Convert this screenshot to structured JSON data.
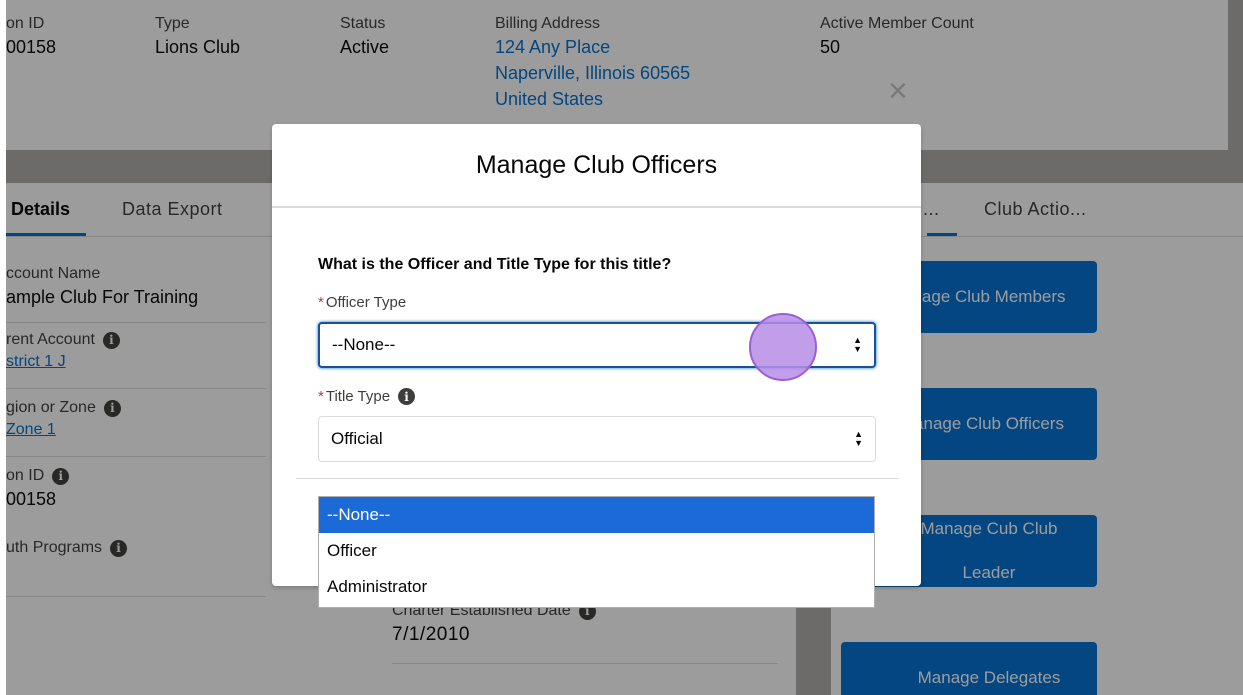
{
  "header": {
    "fields": [
      {
        "label": "on ID",
        "value": "00158"
      },
      {
        "label": "Type",
        "value": "Lions Club"
      },
      {
        "label": "Status",
        "value": "Active"
      },
      {
        "label": "Billing Address",
        "lines": [
          "124 Any Place",
          "Naperville, Illinois 60565",
          "United States"
        ]
      },
      {
        "label": "Active Member Count",
        "value": "50"
      }
    ],
    "close_glyph": "×"
  },
  "details": {
    "tabs": [
      {
        "label": "Details",
        "prefix": "›"
      },
      {
        "label": "Data Export"
      }
    ],
    "fields": [
      {
        "label": "ccount Name",
        "value": "ample Club For Training"
      },
      {
        "label": "rent Account",
        "link": "strict 1 J"
      },
      {
        "label": "gion or Zone",
        "link": "Zone 1"
      },
      {
        "label": "on ID",
        "value": "00158"
      },
      {
        "label": "uth Programs",
        "value": ""
      }
    ],
    "charter": {
      "label": "Charter Established Date",
      "value": "7/1/2010"
    }
  },
  "actions": {
    "tabs": [
      {
        "label": "..."
      },
      {
        "label": "Club Actio..."
      }
    ],
    "buttons": [
      {
        "label": "nage Club Members"
      },
      {
        "label": "anage Club Officers"
      },
      {
        "label": "Manage Cub Club\nLeader",
        "line1": "Manage Cub Club",
        "line2": "Leader"
      },
      {
        "label": "Manage Delegates"
      }
    ]
  },
  "modal": {
    "title": "Manage Club Officers",
    "question": "What is the Officer and Title Type for this title?",
    "officer_type": {
      "label": "Officer Type",
      "value": "--None--"
    },
    "title_type": {
      "label": "Title Type",
      "value": "Official"
    },
    "required_marker": "*"
  },
  "dropdown": {
    "options": [
      "--None--",
      "Officer",
      "Administrator"
    ],
    "selected": "--None--"
  },
  "colors": {
    "brand_blue": "#0070d2",
    "selected_option": "#1b6ad7",
    "required": "#c23934",
    "click_marker": "#b78de6"
  }
}
